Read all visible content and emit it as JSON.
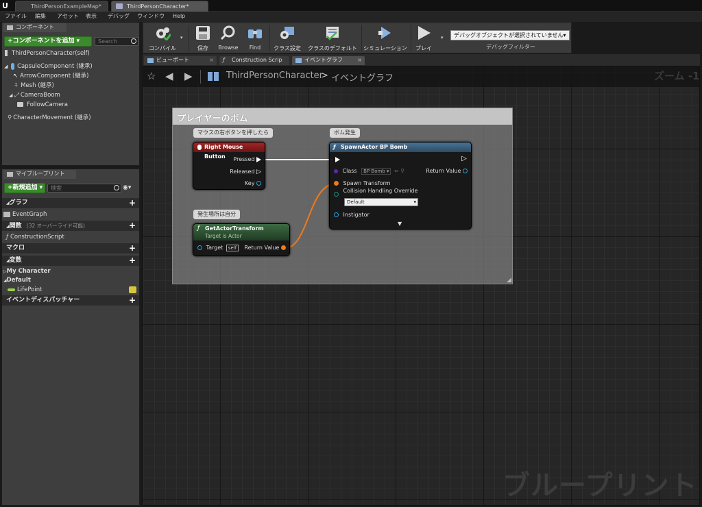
{
  "title_tabs": [
    "ThirdPersonExampleMap*",
    "ThirdPersonCharacter*"
  ],
  "menu": [
    "ファイル",
    "編集",
    "アセット",
    "表示",
    "デバッグ",
    "ウィンドウ",
    "Help"
  ],
  "components": {
    "tab_label": "コンポーネント",
    "add_button": "+コンポーネントを追加 ▾",
    "search_placeholder": "Search",
    "items": [
      "ThirdPersonCharacter(self)",
      "CapsuleComponent (継承)",
      "ArrowComponent (継承)",
      "Mesh (継承)",
      "CameraBoom",
      "FollowCamera",
      "CharacterMovement (継承)"
    ]
  },
  "myblueprint": {
    "tab_label": "マイブループリント",
    "add_button": "+新規追加 ▾",
    "search_placeholder": "検索",
    "graph_header": "グラフ",
    "event_graph": "EventGraph",
    "functions_header": "関数",
    "functions_note": "(32 オーバーライド可能)",
    "construction_script": "ConstructionScript",
    "macros_header": "マクロ",
    "variables_header": "変数",
    "var_cat_1": "My Character",
    "var_cat_2": "Default",
    "var_lifepoint": "LifePoint",
    "dispatchers_header": "イベントディスパッチャー"
  },
  "toolbar": {
    "compile": "コンパイル",
    "save": "保存",
    "browse": "Browse",
    "find": "Find",
    "class_settings": "クラス設定",
    "class_defaults": "クラスのデフォルト",
    "simulation": "シミュレーション",
    "play": "プレイ",
    "debug_select": "デバッグオブジェクトが選択されていません▾",
    "debug_filter": "デバッグフィルター"
  },
  "editor_tabs": [
    "ビューポート",
    "Construction Scrip",
    "イベントグラフ"
  ],
  "breadcrumb": {
    "class_name": "ThirdPersonCharacter",
    "separator": ">",
    "graph_name": "イベントグラフ",
    "zoom": "ズーム -1"
  },
  "graph": {
    "comment_title": "プレイヤーのボム",
    "watermark": "ブループリント",
    "bubble_rmb": "マウスの右ボタンを押したら",
    "bubble_spawn": "ボム発生",
    "bubble_transform": "発生場所は自分",
    "rmb_node": {
      "title": "Right Mouse Button",
      "pressed": "Pressed",
      "released": "Released",
      "key": "Key"
    },
    "spawn_node": {
      "title": "SpawnActor BP Bomb",
      "class_label": "Class",
      "class_value": "BP Bomb ▾",
      "return_value": "Return Value",
      "spawn_transform": "Spawn Transform",
      "collision": "Collision Handling Override",
      "collision_value": "Default",
      "instigator": "Instigator"
    },
    "transform_node": {
      "title": "GetActorTransform",
      "subtitle": "Target is Actor",
      "target": "Target",
      "target_value": "self",
      "return_value": "Return Value"
    }
  },
  "colors": {
    "event_head": "#8f1b1b",
    "func_head": "#2f5a34",
    "call_head": "#3d5f7a",
    "transform_pin": "#f07a1a",
    "object_pin": "#2aa3e0",
    "exec": "#ffffff"
  }
}
